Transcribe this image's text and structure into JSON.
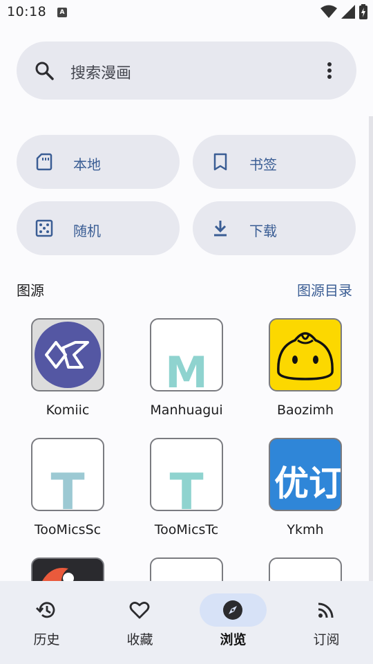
{
  "status_bar": {
    "time": "10:18",
    "notification_icon": "A"
  },
  "search": {
    "placeholder": "搜索漫画"
  },
  "quick_actions": [
    {
      "label": "本地",
      "icon": "sd-card-icon"
    },
    {
      "label": "书签",
      "icon": "bookmark-icon"
    },
    {
      "label": "随机",
      "icon": "dice-icon"
    },
    {
      "label": "下载",
      "icon": "download-icon"
    }
  ],
  "sources_section": {
    "title": "图源",
    "link": "图源目录"
  },
  "sources": [
    {
      "name": "Komiic"
    },
    {
      "name": "Manhuagui",
      "letter": "M"
    },
    {
      "name": "Baozimh"
    },
    {
      "name": "TooMicsSc",
      "letter": "T"
    },
    {
      "name": "TooMicsTc",
      "letter": "T"
    },
    {
      "name": "Ykmh",
      "logo_text": "优订"
    }
  ],
  "nav": [
    {
      "label": "历史",
      "icon": "history-icon"
    },
    {
      "label": "收藏",
      "icon": "heart-icon"
    },
    {
      "label": "浏览",
      "icon": "compass-icon",
      "active": true
    },
    {
      "label": "订阅",
      "icon": "rss-icon"
    }
  ],
  "colors": {
    "accent": "#3a5d94",
    "surface": "#e7e8ef",
    "active_pill": "#d7e2f7",
    "letter_teal": "#8fd3cf"
  }
}
